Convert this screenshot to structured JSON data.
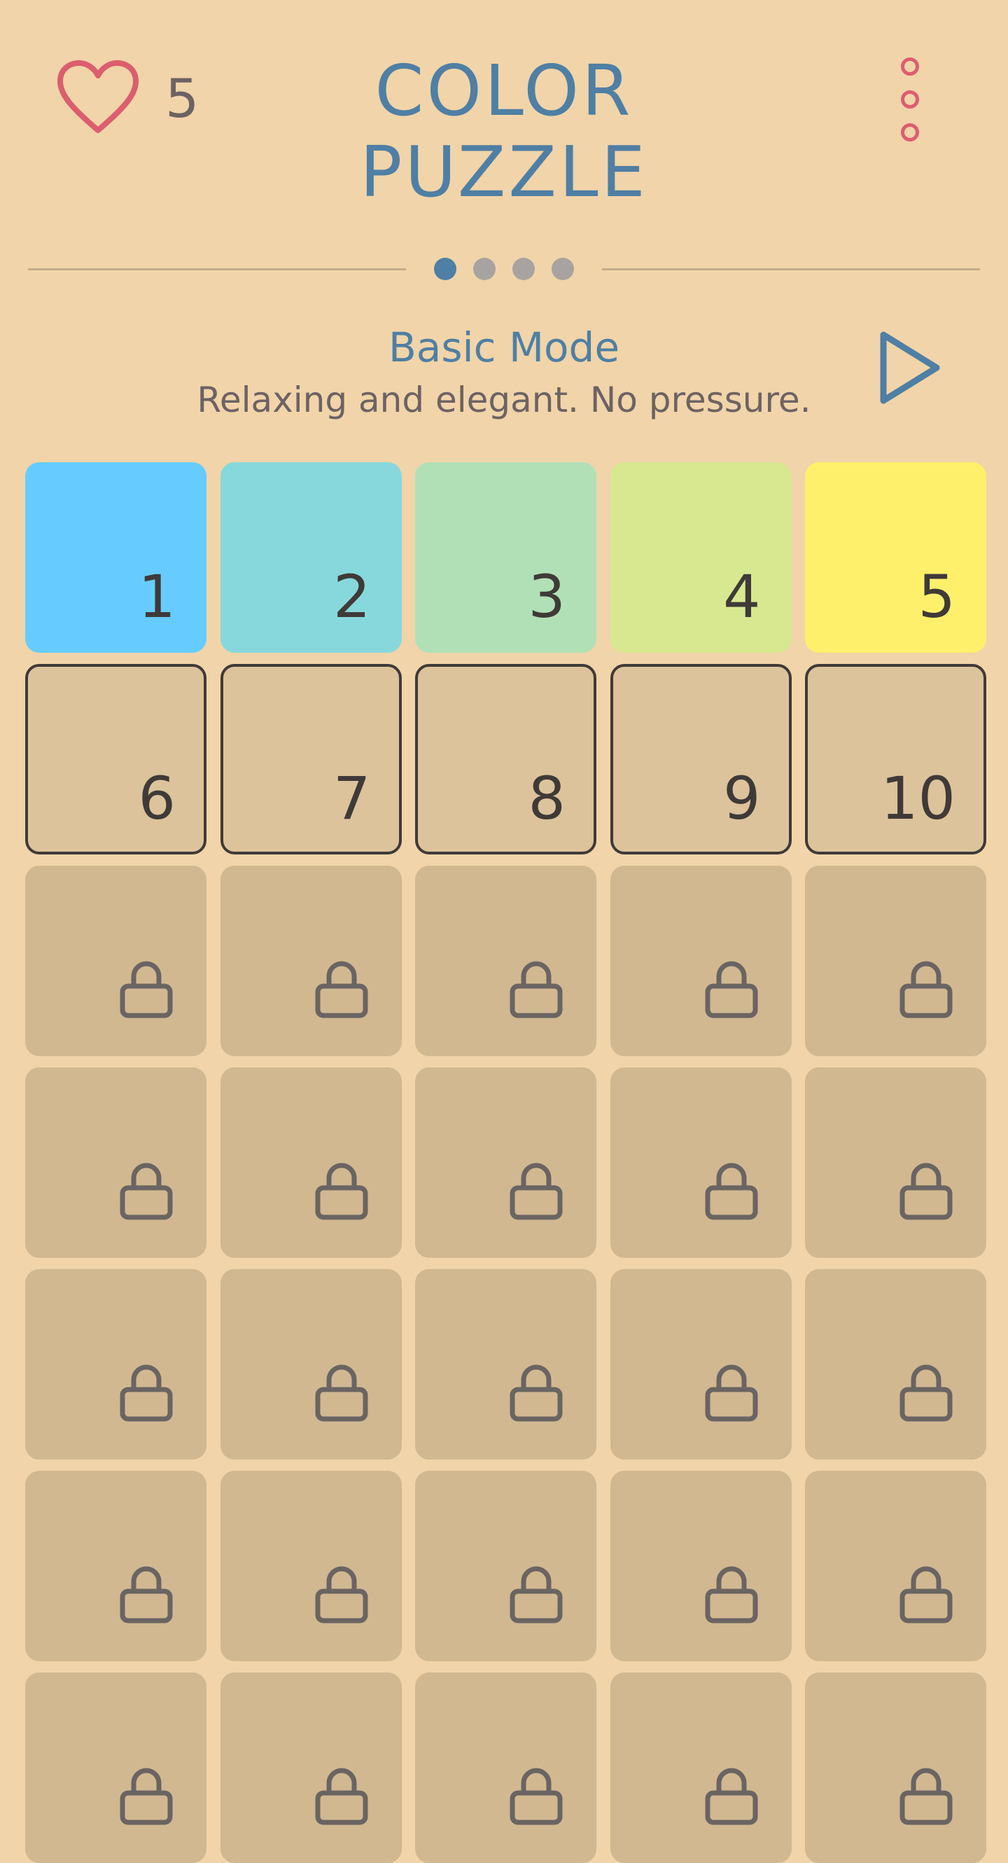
{
  "header": {
    "lives": "5",
    "title_line1": "COLOR",
    "title_line2": "PUZZLE",
    "heart_icon": "heart-outline-icon",
    "menu_icon": "vertical-dots-menu-icon",
    "heart_color": "#dc5e6f",
    "title_color": "#4f7fa4"
  },
  "pager": {
    "pages": 4,
    "active_index": 0
  },
  "mode": {
    "title": "Basic Mode",
    "description": "Relaxing and elegant. No pressure.",
    "play_icon": "play-triangle-icon"
  },
  "levels": [
    {
      "number": "1",
      "state": "completed",
      "color": "#66ccff"
    },
    {
      "number": "2",
      "state": "completed",
      "color": "#87d8dc"
    },
    {
      "number": "3",
      "state": "completed",
      "color": "#b1e0b6"
    },
    {
      "number": "4",
      "state": "completed",
      "color": "#d8e890"
    },
    {
      "number": "5",
      "state": "completed",
      "color": "#fff06c"
    },
    {
      "number": "6",
      "state": "unlocked"
    },
    {
      "number": "7",
      "state": "unlocked"
    },
    {
      "number": "8",
      "state": "unlocked"
    },
    {
      "number": "9",
      "state": "unlocked"
    },
    {
      "number": "10",
      "state": "unlocked"
    },
    {
      "state": "locked"
    },
    {
      "state": "locked"
    },
    {
      "state": "locked"
    },
    {
      "state": "locked"
    },
    {
      "state": "locked"
    },
    {
      "state": "locked"
    },
    {
      "state": "locked"
    },
    {
      "state": "locked"
    },
    {
      "state": "locked"
    },
    {
      "state": "locked"
    },
    {
      "state": "locked"
    },
    {
      "state": "locked"
    },
    {
      "state": "locked"
    },
    {
      "state": "locked"
    },
    {
      "state": "locked"
    },
    {
      "state": "locked"
    },
    {
      "state": "locked"
    },
    {
      "state": "locked"
    },
    {
      "state": "locked"
    },
    {
      "state": "locked"
    },
    {
      "state": "locked"
    },
    {
      "state": "locked"
    },
    {
      "state": "locked"
    },
    {
      "state": "locked"
    },
    {
      "state": "locked"
    }
  ]
}
